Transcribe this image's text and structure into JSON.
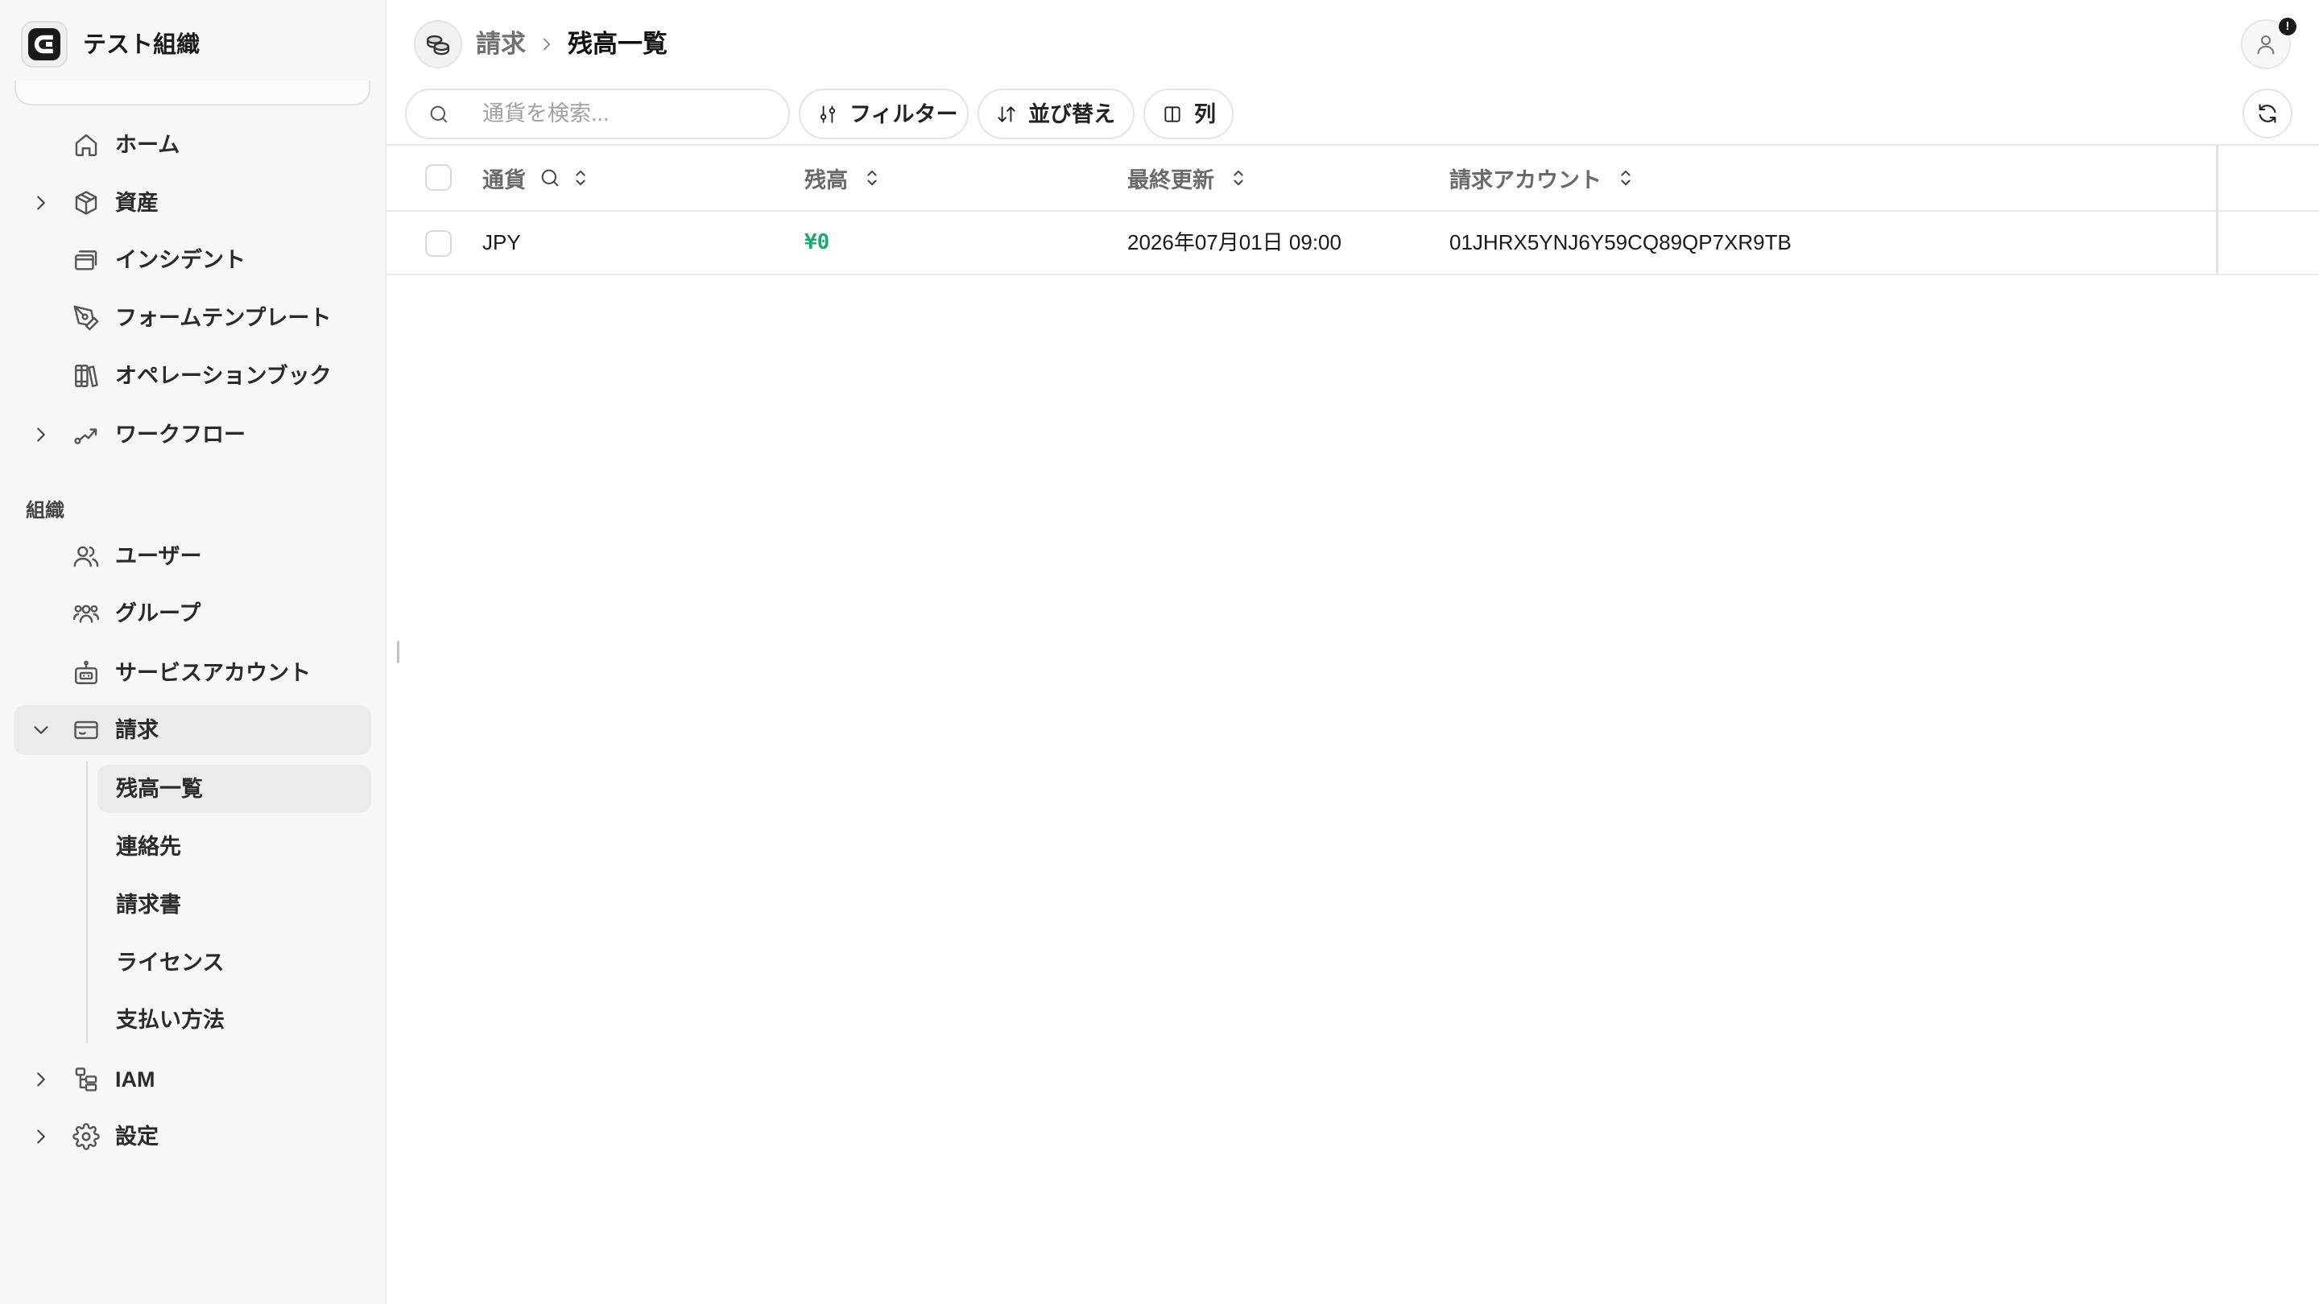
{
  "org": {
    "name": "テスト組織",
    "logo_icon": "org-logo-icon"
  },
  "sidebar": {
    "main_items": [
      {
        "label": "ホーム",
        "icon": "home-icon",
        "expandable": false
      },
      {
        "label": "資産",
        "icon": "cube-icon",
        "expandable": true
      },
      {
        "label": "インシデント",
        "icon": "incident-icon",
        "expandable": false
      },
      {
        "label": "フォームテンプレート",
        "icon": "pen-tool-icon",
        "expandable": false
      },
      {
        "label": "オペレーションブック",
        "icon": "books-icon",
        "expandable": false
      },
      {
        "label": "ワークフロー",
        "icon": "workflow-icon",
        "expandable": true
      }
    ],
    "section_label": "組織",
    "org_items": [
      {
        "label": "ユーザー",
        "icon": "users-icon"
      },
      {
        "label": "グループ",
        "icon": "group-icon"
      },
      {
        "label": "サービスアカウント",
        "icon": "robot-icon"
      }
    ],
    "billing": {
      "label": "請求",
      "icon": "billing-icon",
      "expanded": true,
      "sub_items": [
        {
          "label": "残高一覧",
          "active": true
        },
        {
          "label": "連絡先",
          "active": false
        },
        {
          "label": "請求書",
          "active": false
        },
        {
          "label": "ライセンス",
          "active": false
        },
        {
          "label": "支払い方法",
          "active": false
        }
      ]
    },
    "bottom_items": [
      {
        "label": "IAM",
        "icon": "hierarchy-icon",
        "expandable": true
      },
      {
        "label": "設定",
        "icon": "gear-icon",
        "expandable": true
      }
    ]
  },
  "header": {
    "breadcrumb_icon": "coins-icon",
    "breadcrumb": [
      {
        "label": "請求"
      },
      {
        "label": "残高一覧"
      }
    ],
    "avatar_icon": "user-icon",
    "avatar_badge": "!"
  },
  "toolbar": {
    "search_placeholder": "通貨を検索...",
    "filter_label": "フィルター",
    "sort_label": "並び替え",
    "columns_label": "列",
    "refresh_icon": "refresh-icon"
  },
  "table": {
    "columns": [
      {
        "label": "通貨",
        "searchable": true,
        "sortable": true
      },
      {
        "label": "残高",
        "sortable": true
      },
      {
        "label": "最終更新",
        "sortable": true
      },
      {
        "label": "請求アカウント",
        "sortable": true
      }
    ],
    "rows": [
      {
        "currency": "JPY",
        "balance": "¥0",
        "updated": "2026年07月01日 09:00",
        "billing_account": "01JHRX5YNJ6Y59CQ89QP7XR9TB",
        "selected": false
      }
    ]
  },
  "colors": {
    "sidebar_bg": "#f7f7f7",
    "active_item_bg": "#ebebeb",
    "balance_positive": "#1fa971",
    "border": "#e4e4e4"
  }
}
